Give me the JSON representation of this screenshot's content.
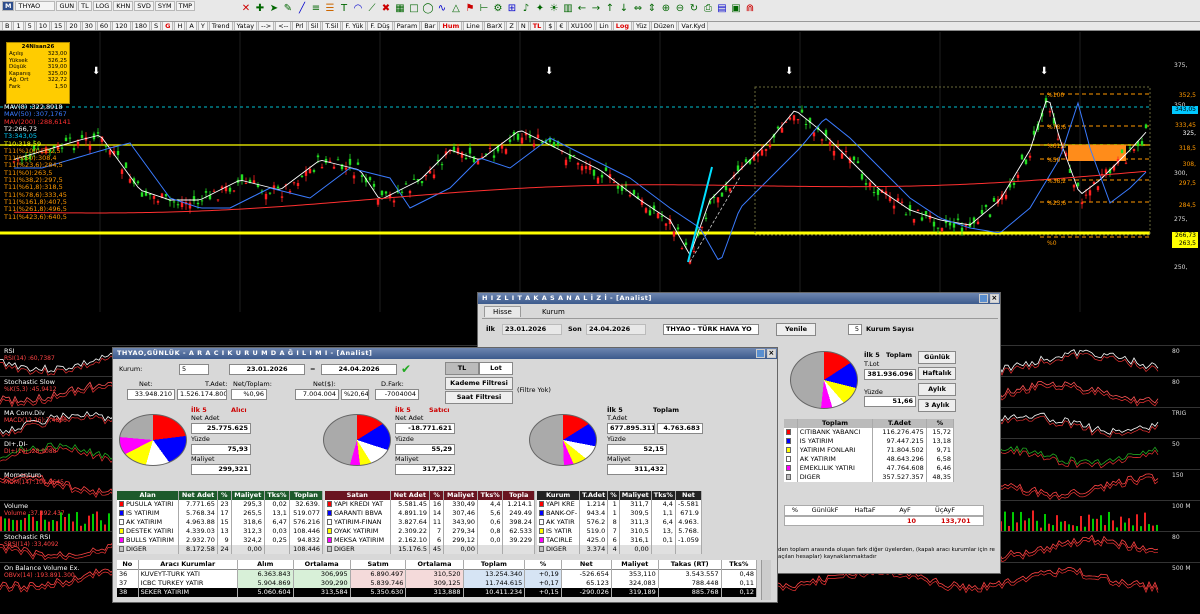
{
  "toolbar": {
    "symbol_left": "THYAO",
    "row1_buttons": [
      "GUN",
      "TL",
      "LOG",
      "KHN",
      "SVD",
      "SYM",
      "TMP"
    ],
    "row2_prefix": [
      "B",
      "1",
      "5",
      "10",
      "15",
      "20",
      "30",
      "60",
      "120",
      "180",
      "S",
      "G",
      "H",
      "A",
      "Y"
    ],
    "row2_tools": [
      "Trend",
      "Yatay",
      "-->",
      "<--",
      "Prl",
      "Sil",
      "T.Sil",
      "F. Yük",
      "F. Düş",
      "Param",
      "Bar",
      "Hum",
      "Line",
      "BarX",
      "Z",
      "N",
      "TL",
      "$",
      "€",
      "XU100",
      "Lin",
      "Log",
      "Yüz",
      "Düzen",
      "Var.Kyd"
    ],
    "symbol_right": "XU100"
  },
  "chart": {
    "date_label": "24Nisan26",
    "info": [
      [
        "Açılış",
        "323,00"
      ],
      [
        "Yüksek",
        "326,25"
      ],
      [
        "Düşük",
        "319,00"
      ],
      [
        "Kapanış",
        "325,00"
      ],
      [
        "Ağ. Ort",
        "322,72"
      ],
      [
        "Fark",
        "1,50"
      ]
    ],
    "indicators": [
      {
        "text": "MAV(8)   :322,8918",
        "color": "#ffffff"
      },
      {
        "text": "MAV(50)  :307,1767",
        "color": "#3a7bff"
      },
      {
        "text": "MAV(200) :288,6141",
        "color": "#ff3030"
      },
      {
        "text": "T2:266,73",
        "color": "#ffffff"
      },
      {
        "text": "T3:343,05",
        "color": "#00d0ff"
      },
      {
        "text": "T10:318,59",
        "color": "#ffff00"
      },
      {
        "text": "T11(%100):352,5",
        "color": "#ff9900"
      },
      {
        "text": "T11(%50):308,4",
        "color": "#ff9900"
      },
      {
        "text": "T11(%23,6):284,5",
        "color": "#ff9900"
      },
      {
        "text": "T11(%0):263,5",
        "color": "#ff9900"
      },
      {
        "text": "T11(%38,2):297,5",
        "color": "#ff9900"
      },
      {
        "text": "T11(%61,8):318,5",
        "color": "#ff9900"
      },
      {
        "text": "T11(%78,6):333,45",
        "color": "#ff9900"
      },
      {
        "text": "T11(%161,8):407,5",
        "color": "#ff9900"
      },
      {
        "text": "T11(%261,8):496,5",
        "color": "#ff9900"
      },
      {
        "text": "T11(%423,6):640,5",
        "color": "#ff9900"
      }
    ],
    "yaxis": [
      "375,",
      "350,",
      "325,",
      "300,",
      "275,",
      "250,"
    ],
    "price_tags": [
      {
        "text": "352,5",
        "bg": "#000",
        "color": "#ff9900"
      },
      {
        "text": "343,05",
        "bg": "#00c8ff",
        "color": "#000"
      },
      {
        "text": "333,45",
        "bg": "#000",
        "color": "#ff9900"
      },
      {
        "text": "325,",
        "bg": "#000",
        "color": "#fff"
      },
      {
        "text": "318,5",
        "bg": "#000",
        "color": "#ff9900"
      },
      {
        "text": "308,",
        "bg": "#000",
        "color": "#ff9900"
      },
      {
        "text": "297,5",
        "bg": "#000",
        "color": "#ff9900"
      },
      {
        "text": "284,5",
        "bg": "#000",
        "color": "#ff9900"
      },
      {
        "text": "266,73",
        "bg": "#ffff00",
        "color": "#000"
      },
      {
        "text": "263,5",
        "bg": "#ffff00",
        "color": "#000"
      }
    ],
    "fib_labels": [
      "%100",
      "%78,6",
      "%61,8",
      "%50",
      "%38,2",
      "%23,6",
      "%0"
    ]
  },
  "panels": [
    {
      "name": "RSI",
      "label": "RSI",
      "sub": "RSI(14)   :60,7387",
      "right": "80"
    },
    {
      "name": "stochastic-slow",
      "label": "Stochastic Slow",
      "sub": "%K(5,3)  :45,9412",
      "right": "80"
    },
    {
      "name": "macd",
      "label": "MA Conv.Div",
      "sub": "MACD(12,26):7,4806",
      "right": "TRIG"
    },
    {
      "name": "dmi",
      "label": "DI+,DI-",
      "sub": "DI+(14)  :28,9088",
      "right": "50"
    },
    {
      "name": "momentum",
      "label": "Momentum",
      "sub": "MOM(14)  :101,3645",
      "right": "150"
    },
    {
      "name": "volume",
      "label": "Volume",
      "sub": "Volume   :37.892.437",
      "right": "100 M"
    },
    {
      "name": "stoch-rsi",
      "label": "Stochastic RSI",
      "sub": "SRSI(14)  :33,4092",
      "right": "80"
    },
    {
      "name": "obv",
      "label": "On Balance Volume Ex.",
      "sub": "OBVx(14) :193.891.300",
      "right": "500 M"
    }
  ],
  "hizli": {
    "title": "H I Z L I   T A K A S   A N A L İ Z İ  -  [Analist]",
    "tabs": [
      "Hisse",
      "Kurum"
    ],
    "ilk_label": "İlk",
    "ilk_date": "23.01.2026",
    "son_label": "Son",
    "son_date": "24.04.2026",
    "stock": "THYAO - TÜRK HAVA YO",
    "yenile": "Yenile",
    "kurum_sayisi": "5",
    "kurum_sayisi_label": "Kurum Sayısı",
    "ilk5": "İlk 5",
    "toplam": "Toplam",
    "tlot_label": "T.Lot",
    "tlot": "381.936.096",
    "yuzde_label": "Yüzde",
    "yuzde": "51,66",
    "period_buttons": [
      "Günlük",
      "Haftalık",
      "Aylık",
      "3 Aylık"
    ],
    "table_headers": [
      "",
      "Toplam",
      "T.Adet",
      "%"
    ],
    "rows": [
      {
        "color": "#ff0000",
        "name": "CITIBANK YABANCI",
        "val": "116.276.475",
        "pct": "15,72"
      },
      {
        "color": "#0000ff",
        "name": "IS YATIRIM",
        "val": "97.447.215",
        "pct": "13,18"
      },
      {
        "color": "#ffff00",
        "name": "YATIRIM FONLARI",
        "val": "71.804.502",
        "pct": "9,71"
      },
      {
        "color": "#ffffff",
        "name": "AK YATIRIM",
        "val": "48.643.296",
        "pct": "6,58"
      },
      {
        "color": "#ff00ff",
        "name": "EMEKLILIK YATIRI",
        "val": "47.764.608",
        "pct": "6,46"
      },
      {
        "color": "#c0c0c0",
        "name": "DIGER",
        "val": "357.527.357",
        "pct": "48,35"
      }
    ],
    "bottom_headers": [
      "%",
      "GünlükF",
      "HaftaF",
      "AyF",
      "ÜçAyF"
    ],
    "bottom_vals": [
      "10",
      "133,701"
    ],
    "note": "den toplam arasında oluşan fark diğer üyelerden, (kapalı aracı kurumlar için re açılan hesaplar) kaynaklanmaktadır"
  },
  "dagilim": {
    "title": "THYAO,GÜNLÜK - A R A C I   K U R U M   D A Ğ I L I M I - [Analist]",
    "kurum_label": "Kurum:",
    "kurum": "5",
    "date1": "23.01.2026",
    "eq": "=",
    "date2": "24.04.2026",
    "tl": "TL",
    "lot": "Lot",
    "kademe": "Kademe Filtresi",
    "saat": "Saat Filtresi",
    "filtre_yok": "(Filtre Yok)",
    "summary_labels": [
      "Net:",
      "T.Adet:",
      "Net/Toplam:",
      "Net($):",
      "D.Fark:"
    ],
    "summary_values": [
      "33.948.210",
      "1.526.174.800",
      "%0,96",
      "7.004.004",
      "%20,64",
      "-7004004"
    ],
    "pies": [
      {
        "title": "İlk 5",
        "title2": "Alıcı",
        "l1": "Net Adet",
        "v1": "25.775.625",
        "l2": "Yüzde",
        "v2": "75,93",
        "l3": "Maliyet",
        "v3": "299,321"
      },
      {
        "title": "İlk 5",
        "title2": "Satıcı",
        "l1": "Net Adet",
        "v1": "-18.771.621",
        "l2": "Yüzde",
        "v2": "55,29",
        "l3": "Maliyet",
        "v3": "317,322"
      },
      {
        "title": "İlk 5",
        "title2": "Toplam",
        "l1": "T.Adet",
        "v1": "677.895.311",
        "v1b": "4.763.683",
        "l2": "Yüzde",
        "v2": "52,15",
        "l3": "Maliyet",
        "v3": "311,432"
      }
    ],
    "alan_headers": [
      "Alan",
      "Net Adet",
      "%",
      "Maliyet",
      "Tks%",
      "Toplan"
    ],
    "alan_rows": [
      {
        "c": "#ff0000",
        "n": "PUSULA YATIRI",
        "a": "7.771.65",
        "p": "23",
        "m": "295,3",
        "t": "0,02",
        "to": "32.639."
      },
      {
        "c": "#0000ff",
        "n": "IS YATIRIM",
        "a": "5.768.34",
        "p": "17",
        "m": "265,5",
        "t": "13,1",
        "to": "519.077"
      },
      {
        "c": "#ffffff",
        "n": "AK YATIRIM",
        "a": "4.963.88",
        "p": "15",
        "m": "318,6",
        "t": "6,47",
        "to": "576.216"
      },
      {
        "c": "#ffff00",
        "n": "DESTEK YATIRI",
        "a": "4.339.03",
        "p": "13",
        "m": "312,3",
        "t": "0,03",
        "to": "108.446"
      },
      {
        "c": "#ff00ff",
        "n": "BULLS YATIRIM",
        "a": "2.932.70",
        "p": "9",
        "m": "324,2",
        "t": "0,25",
        "to": "94.832"
      },
      {
        "c": "#c0c0c0",
        "n": "DIGER",
        "a": "8.172.58",
        "p": "24",
        "m": "0,00",
        "t": "",
        "to": "108.446"
      }
    ],
    "satan_headers": [
      "Satan",
      "Net Adet",
      "%",
      "Maliyet",
      "Tks%",
      "Topla"
    ],
    "satan_rows": [
      {
        "c": "#ff0000",
        "n": "YAPI KREDI YAT",
        "a": "5.581.45",
        "p": "16",
        "m": "330,49",
        "t": "4,4",
        "to": "1.214.1"
      },
      {
        "c": "#0000ff",
        "n": "GARANTI BBVA",
        "a": "4.891.19",
        "p": "14",
        "m": "307,46",
        "t": "5,6",
        "to": "249.49"
      },
      {
        "c": "#ffffff",
        "n": "YATIRIM-FINAN",
        "a": "3.827.64",
        "p": "11",
        "m": "343,90",
        "t": "0,6",
        "to": "398.24"
      },
      {
        "c": "#ffff00",
        "n": "OYAK YATIRIM",
        "a": "2.309.22",
        "p": "7",
        "m": "279,34",
        "t": "0,8",
        "to": "62.533"
      },
      {
        "c": "#ff00ff",
        "n": "MEKSA YATIRIM",
        "a": "2.162.10",
        "p": "6",
        "m": "299,12",
        "t": "0,0",
        "to": "39.229"
      },
      {
        "c": "#c0c0c0",
        "n": "DIGER",
        "a": "15.176.5",
        "p": "45",
        "m": "0,00",
        "t": "",
        "to": ""
      }
    ],
    "kurum_headers": [
      "Kurum",
      "T.Adet",
      "%",
      "Maliyet",
      "Tks%",
      "Net"
    ],
    "kurum_rows": [
      {
        "c": "#ff0000",
        "n": "YAPI KRE",
        "a": "1.214",
        "p": "1",
        "m": "311,7",
        "t": "4,4",
        "to": "-5.581"
      },
      {
        "c": "#0000ff",
        "n": "BANK-OF-",
        "a": "943.4",
        "p": "1",
        "m": "309,5",
        "t": "1,1",
        "to": "671.9"
      },
      {
        "c": "#ffffff",
        "n": "AK YATIR",
        "a": "576.2",
        "p": "8",
        "m": "311,3",
        "t": "6,4",
        "to": "4.963."
      },
      {
        "c": "#ffff00",
        "n": "IS YATIR",
        "a": "519.0",
        "p": "7",
        "m": "310,5",
        "t": "13,",
        "to": "5.768."
      },
      {
        "c": "#ff00ff",
        "n": "TACIRLE",
        "a": "425.0",
        "p": "6",
        "m": "316,1",
        "t": "0,1",
        "to": "-1.059"
      },
      {
        "c": "#c0c0c0",
        "n": "DIGER",
        "a": "3.374",
        "p": "4",
        "m": "0,00",
        "t": "",
        "to": ""
      }
    ],
    "bottom_headers": [
      "No",
      "Aracı Kurumlar",
      "Alım",
      "Ortalama",
      "Satım",
      "Ortalama",
      "Toplam",
      "%",
      "Net",
      "Maliyet",
      "Takas (RT)",
      "Tks%"
    ],
    "bottom_rows": [
      {
        "no": "36",
        "n": "KUVEYT-TURK YATI",
        "al": "6.363.843",
        "o1": "306,995",
        "sa": "6.890.497",
        "o2": "310,520",
        "to": "13.254.340",
        "p": "+0,19",
        "ne": "-526.654",
        "ma": "353,110",
        "tk": "3.543.557",
        "tp": "0,48",
        "sel": false
      },
      {
        "no": "37",
        "n": "ICBC TURKEY YATIR",
        "al": "5.904.869",
        "o1": "309,290",
        "sa": "5.839.746",
        "o2": "309,125",
        "to": "11.744.615",
        "p": "+0,17",
        "ne": "65.123",
        "ma": "324,083",
        "tk": "788.448",
        "tp": "0,11",
        "sel": false
      },
      {
        "no": "38",
        "n": "SEKER YATIRIM",
        "al": "5.060.604",
        "o1": "313,584",
        "sa": "5.350.630",
        "o2": "313,888",
        "to": "10.411.234",
        "p": "+0,15",
        "ne": "-290.026",
        "ma": "319,189",
        "tk": "885.768",
        "tp": "0,12",
        "sel": true
      }
    ]
  }
}
